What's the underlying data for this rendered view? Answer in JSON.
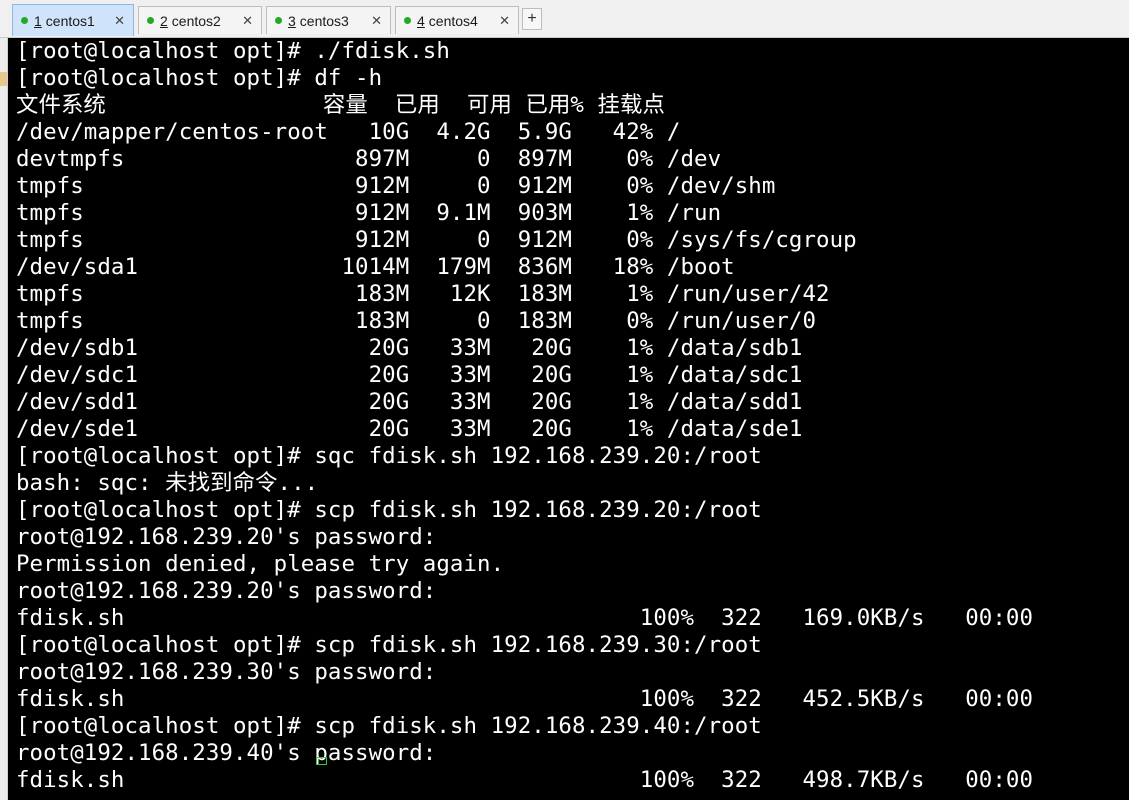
{
  "tabs": [
    {
      "number": "1",
      "label": "centos1",
      "active": true,
      "status_color": "#22aa22",
      "close": "✕"
    },
    {
      "number": "2",
      "label": "centos2",
      "active": false,
      "status_color": "#22aa22",
      "close": "✕"
    },
    {
      "number": "3",
      "label": "centos3",
      "active": false,
      "status_color": "#22aa22",
      "close": "✕"
    },
    {
      "number": "4",
      "label": "centos4",
      "active": false,
      "status_color": "#22aa22",
      "close": "✕"
    }
  ],
  "add_tab_label": "+",
  "terminal": {
    "lines": [
      "[root@localhost opt]# ./fdisk.sh",
      "[root@localhost opt]# df -h",
      "文件系统                容量  已用  可用 已用% 挂载点",
      "/dev/mapper/centos-root   10G  4.2G  5.9G   42% /",
      "devtmpfs                 897M     0  897M    0% /dev",
      "tmpfs                    912M     0  912M    0% /dev/shm",
      "tmpfs                    912M  9.1M  903M    1% /run",
      "tmpfs                    912M     0  912M    0% /sys/fs/cgroup",
      "/dev/sda1               1014M  179M  836M   18% /boot",
      "tmpfs                    183M   12K  183M    1% /run/user/42",
      "tmpfs                    183M     0  183M    0% /run/user/0",
      "/dev/sdb1                 20G   33M   20G    1% /data/sdb1",
      "/dev/sdc1                 20G   33M   20G    1% /data/sdc1",
      "/dev/sdd1                 20G   33M   20G    1% /data/sdd1",
      "/dev/sde1                 20G   33M   20G    1% /data/sde1",
      "[root@localhost opt]# sqc fdisk.sh 192.168.239.20:/root",
      "bash: sqc: 未找到命令...",
      "[root@localhost opt]# scp fdisk.sh 192.168.239.20:/root",
      "root@192.168.239.20's password:",
      "Permission denied, please try again.",
      "root@192.168.239.20's password:",
      "fdisk.sh                                      100%  322   169.0KB/s   00:00",
      "[root@localhost opt]# scp fdisk.sh 192.168.239.30:/root",
      "root@192.168.239.30's password:",
      "fdisk.sh                                      100%  322   452.5KB/s   00:00",
      "[root@localhost opt]# scp fdisk.sh 192.168.239.40:/root",
      "root@192.168.239.40's password:",
      "fdisk.sh                                      100%  322   498.7KB/s   00:00"
    ],
    "cursor_color": "#2ecc40"
  }
}
